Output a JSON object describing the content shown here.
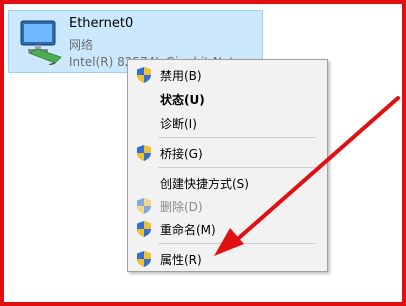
{
  "adapter": {
    "name": "Ethernet0",
    "kind": "网络",
    "device": "Intel(R) 82574L Gigabit Net..."
  },
  "menu": {
    "items": [
      {
        "label": "禁用(B)",
        "icon": "shield-icon",
        "bold": false,
        "disabled": false
      },
      {
        "label": "状态(U)",
        "icon": "",
        "bold": true,
        "disabled": false
      },
      {
        "label": "诊断(I)",
        "icon": "",
        "bold": false,
        "disabled": false
      },
      {
        "label": "桥接(G)",
        "icon": "shield-icon",
        "bold": false,
        "disabled": false
      },
      {
        "label": "创建快捷方式(S)",
        "icon": "",
        "bold": false,
        "disabled": false
      },
      {
        "label": "删除(D)",
        "icon": "shield-icon",
        "bold": false,
        "disabled": true
      },
      {
        "label": "重命名(M)",
        "icon": "shield-icon",
        "bold": false,
        "disabled": false
      },
      {
        "label": "属性(R)",
        "icon": "shield-icon",
        "bold": false,
        "disabled": false
      }
    ]
  },
  "colors": {
    "selection": "#cce8ff",
    "annotation_red": "#e01010",
    "menu_bg": "#f2f2f2"
  }
}
